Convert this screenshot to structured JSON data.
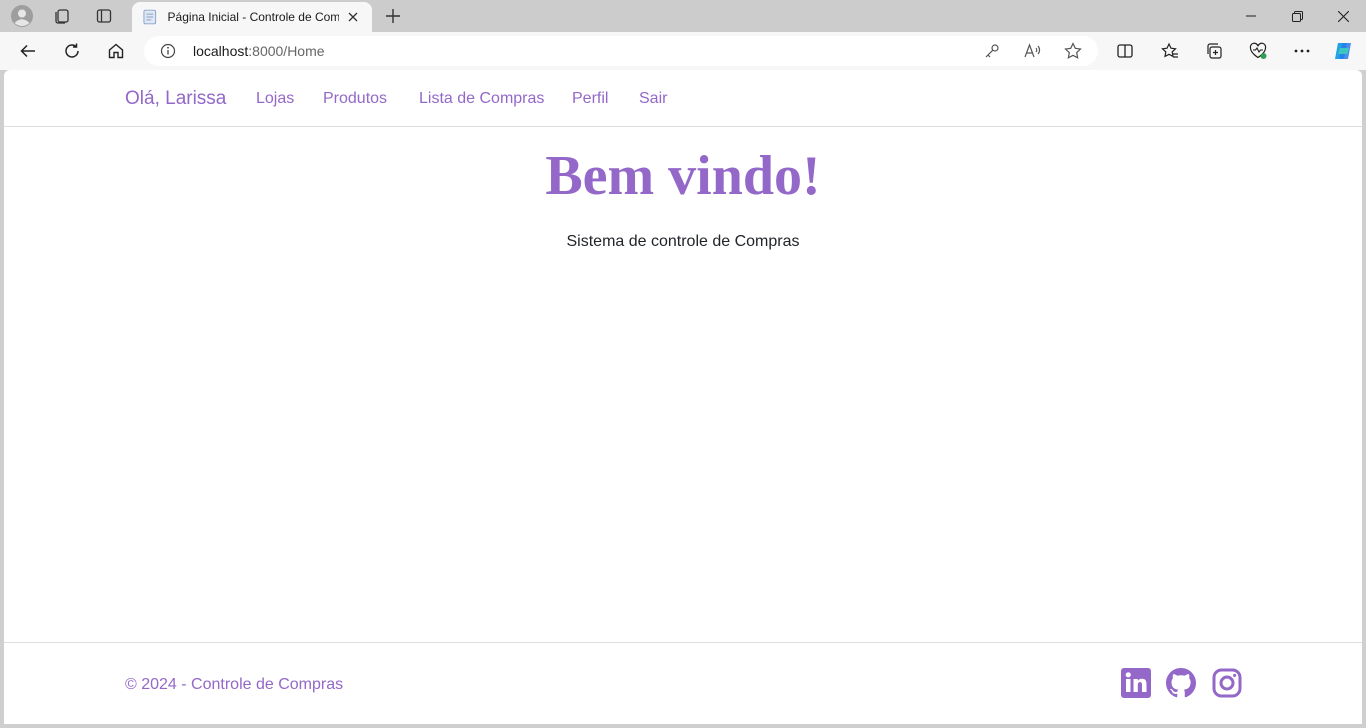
{
  "browser": {
    "tab_title": "Página Inicial - Controle de Compras",
    "url_host": "localhost",
    "url_rest": ":8000/Home"
  },
  "navbar": {
    "brand": "Olá, Larissa",
    "links": [
      "Lojas",
      "Produtos",
      "Lista de Compras",
      "Perfil",
      "Sair"
    ]
  },
  "main": {
    "title": "Bem vindo!",
    "subtitle": "Sistema de controle de Compras"
  },
  "footer": {
    "copyright": "© 2024 - Controle de Compras",
    "social_icons": [
      "linkedin-icon",
      "github-icon",
      "instagram-icon"
    ]
  },
  "colors": {
    "accent": "#9368c8",
    "text": "#212529"
  }
}
